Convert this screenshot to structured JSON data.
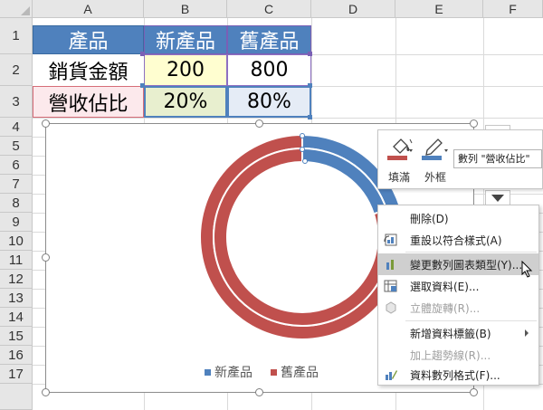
{
  "columns": [
    "A",
    "B",
    "C",
    "D",
    "E",
    "F"
  ],
  "rows": [
    "1",
    "2",
    "3",
    "4",
    "5",
    "6",
    "7",
    "8",
    "9",
    "10",
    "11",
    "12",
    "13",
    "14",
    "15",
    "16",
    "17"
  ],
  "table": {
    "header": [
      "產品",
      "新產品",
      "舊產品"
    ],
    "row2": [
      "銷貨金額",
      "200",
      "800"
    ],
    "row3": [
      "營收佔比",
      "20%",
      "80%"
    ]
  },
  "chart": {
    "legend": [
      {
        "name": "新產品",
        "color": "#4f81bd"
      },
      {
        "name": "舊產品",
        "color": "#c0504d"
      }
    ]
  },
  "chart_data": {
    "type": "pie",
    "subtype": "doughnut",
    "series": [
      {
        "name": "銷貨金額",
        "values": [
          200,
          800
        ]
      },
      {
        "name": "營收佔比",
        "values": [
          20,
          80
        ]
      }
    ],
    "categories": [
      "新產品",
      "舊產品"
    ],
    "colors": [
      "#4f81bd",
      "#c0504d"
    ],
    "legend_position": "bottom"
  },
  "mini_toolbar": {
    "fill_label": "填滿",
    "outline_label": "外框",
    "series_select": "數列 \"營收佔比\""
  },
  "context_menu": {
    "items": [
      {
        "label": "刪除(D)",
        "disabled": false,
        "icon": ""
      },
      {
        "label": "重設以符合樣式(A)",
        "disabled": false,
        "icon": "reset-style-icon"
      },
      {
        "label": "變更數列圖表類型(Y)...",
        "disabled": false,
        "icon": "change-chart-type-icon",
        "highlighted": true
      },
      {
        "label": "選取資料(E)...",
        "disabled": false,
        "icon": "select-data-icon"
      },
      {
        "label": "立體旋轉(R)...",
        "disabled": true,
        "icon": "3d-rotation-icon"
      },
      {
        "label": "新增資料標籤(B)",
        "disabled": false,
        "icon": "",
        "submenu": true
      },
      {
        "label": "加上趨勢線(R)...",
        "disabled": true,
        "icon": ""
      },
      {
        "label": "資料數列格式(F)...",
        "disabled": false,
        "icon": "format-series-icon"
      }
    ]
  }
}
